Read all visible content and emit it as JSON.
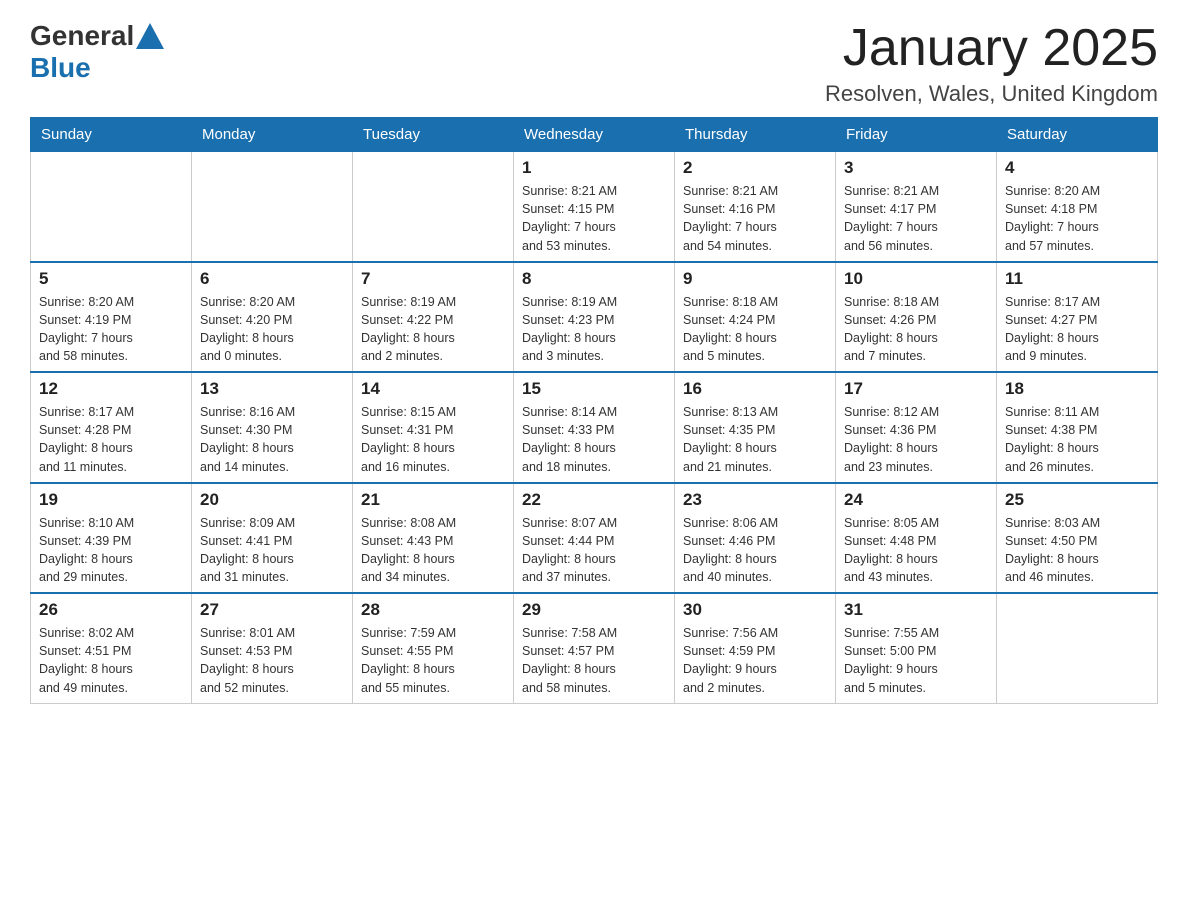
{
  "header": {
    "logo_general": "General",
    "logo_blue": "Blue",
    "month_title": "January 2025",
    "location": "Resolven, Wales, United Kingdom"
  },
  "weekdays": [
    "Sunday",
    "Monday",
    "Tuesday",
    "Wednesday",
    "Thursday",
    "Friday",
    "Saturday"
  ],
  "weeks": [
    {
      "days": [
        {
          "number": "",
          "info": ""
        },
        {
          "number": "",
          "info": ""
        },
        {
          "number": "",
          "info": ""
        },
        {
          "number": "1",
          "info": "Sunrise: 8:21 AM\nSunset: 4:15 PM\nDaylight: 7 hours\nand 53 minutes."
        },
        {
          "number": "2",
          "info": "Sunrise: 8:21 AM\nSunset: 4:16 PM\nDaylight: 7 hours\nand 54 minutes."
        },
        {
          "number": "3",
          "info": "Sunrise: 8:21 AM\nSunset: 4:17 PM\nDaylight: 7 hours\nand 56 minutes."
        },
        {
          "number": "4",
          "info": "Sunrise: 8:20 AM\nSunset: 4:18 PM\nDaylight: 7 hours\nand 57 minutes."
        }
      ]
    },
    {
      "days": [
        {
          "number": "5",
          "info": "Sunrise: 8:20 AM\nSunset: 4:19 PM\nDaylight: 7 hours\nand 58 minutes."
        },
        {
          "number": "6",
          "info": "Sunrise: 8:20 AM\nSunset: 4:20 PM\nDaylight: 8 hours\nand 0 minutes."
        },
        {
          "number": "7",
          "info": "Sunrise: 8:19 AM\nSunset: 4:22 PM\nDaylight: 8 hours\nand 2 minutes."
        },
        {
          "number": "8",
          "info": "Sunrise: 8:19 AM\nSunset: 4:23 PM\nDaylight: 8 hours\nand 3 minutes."
        },
        {
          "number": "9",
          "info": "Sunrise: 8:18 AM\nSunset: 4:24 PM\nDaylight: 8 hours\nand 5 minutes."
        },
        {
          "number": "10",
          "info": "Sunrise: 8:18 AM\nSunset: 4:26 PM\nDaylight: 8 hours\nand 7 minutes."
        },
        {
          "number": "11",
          "info": "Sunrise: 8:17 AM\nSunset: 4:27 PM\nDaylight: 8 hours\nand 9 minutes."
        }
      ]
    },
    {
      "days": [
        {
          "number": "12",
          "info": "Sunrise: 8:17 AM\nSunset: 4:28 PM\nDaylight: 8 hours\nand 11 minutes."
        },
        {
          "number": "13",
          "info": "Sunrise: 8:16 AM\nSunset: 4:30 PM\nDaylight: 8 hours\nand 14 minutes."
        },
        {
          "number": "14",
          "info": "Sunrise: 8:15 AM\nSunset: 4:31 PM\nDaylight: 8 hours\nand 16 minutes."
        },
        {
          "number": "15",
          "info": "Sunrise: 8:14 AM\nSunset: 4:33 PM\nDaylight: 8 hours\nand 18 minutes."
        },
        {
          "number": "16",
          "info": "Sunrise: 8:13 AM\nSunset: 4:35 PM\nDaylight: 8 hours\nand 21 minutes."
        },
        {
          "number": "17",
          "info": "Sunrise: 8:12 AM\nSunset: 4:36 PM\nDaylight: 8 hours\nand 23 minutes."
        },
        {
          "number": "18",
          "info": "Sunrise: 8:11 AM\nSunset: 4:38 PM\nDaylight: 8 hours\nand 26 minutes."
        }
      ]
    },
    {
      "days": [
        {
          "number": "19",
          "info": "Sunrise: 8:10 AM\nSunset: 4:39 PM\nDaylight: 8 hours\nand 29 minutes."
        },
        {
          "number": "20",
          "info": "Sunrise: 8:09 AM\nSunset: 4:41 PM\nDaylight: 8 hours\nand 31 minutes."
        },
        {
          "number": "21",
          "info": "Sunrise: 8:08 AM\nSunset: 4:43 PM\nDaylight: 8 hours\nand 34 minutes."
        },
        {
          "number": "22",
          "info": "Sunrise: 8:07 AM\nSunset: 4:44 PM\nDaylight: 8 hours\nand 37 minutes."
        },
        {
          "number": "23",
          "info": "Sunrise: 8:06 AM\nSunset: 4:46 PM\nDaylight: 8 hours\nand 40 minutes."
        },
        {
          "number": "24",
          "info": "Sunrise: 8:05 AM\nSunset: 4:48 PM\nDaylight: 8 hours\nand 43 minutes."
        },
        {
          "number": "25",
          "info": "Sunrise: 8:03 AM\nSunset: 4:50 PM\nDaylight: 8 hours\nand 46 minutes."
        }
      ]
    },
    {
      "days": [
        {
          "number": "26",
          "info": "Sunrise: 8:02 AM\nSunset: 4:51 PM\nDaylight: 8 hours\nand 49 minutes."
        },
        {
          "number": "27",
          "info": "Sunrise: 8:01 AM\nSunset: 4:53 PM\nDaylight: 8 hours\nand 52 minutes."
        },
        {
          "number": "28",
          "info": "Sunrise: 7:59 AM\nSunset: 4:55 PM\nDaylight: 8 hours\nand 55 minutes."
        },
        {
          "number": "29",
          "info": "Sunrise: 7:58 AM\nSunset: 4:57 PM\nDaylight: 8 hours\nand 58 minutes."
        },
        {
          "number": "30",
          "info": "Sunrise: 7:56 AM\nSunset: 4:59 PM\nDaylight: 9 hours\nand 2 minutes."
        },
        {
          "number": "31",
          "info": "Sunrise: 7:55 AM\nSunset: 5:00 PM\nDaylight: 9 hours\nand 5 minutes."
        },
        {
          "number": "",
          "info": ""
        }
      ]
    }
  ]
}
